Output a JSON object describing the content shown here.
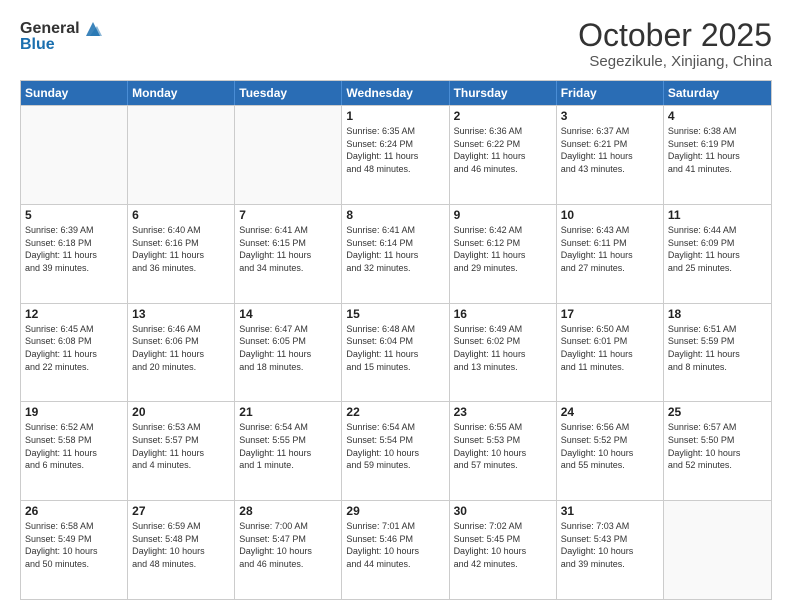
{
  "header": {
    "logo_general": "General",
    "logo_blue": "Blue",
    "month": "October 2025",
    "location": "Segezikule, Xinjiang, China"
  },
  "days_of_week": [
    "Sunday",
    "Monday",
    "Tuesday",
    "Wednesday",
    "Thursday",
    "Friday",
    "Saturday"
  ],
  "weeks": [
    [
      {
        "day": "",
        "info": ""
      },
      {
        "day": "",
        "info": ""
      },
      {
        "day": "",
        "info": ""
      },
      {
        "day": "1",
        "info": "Sunrise: 6:35 AM\nSunset: 6:24 PM\nDaylight: 11 hours\nand 48 minutes."
      },
      {
        "day": "2",
        "info": "Sunrise: 6:36 AM\nSunset: 6:22 PM\nDaylight: 11 hours\nand 46 minutes."
      },
      {
        "day": "3",
        "info": "Sunrise: 6:37 AM\nSunset: 6:21 PM\nDaylight: 11 hours\nand 43 minutes."
      },
      {
        "day": "4",
        "info": "Sunrise: 6:38 AM\nSunset: 6:19 PM\nDaylight: 11 hours\nand 41 minutes."
      }
    ],
    [
      {
        "day": "5",
        "info": "Sunrise: 6:39 AM\nSunset: 6:18 PM\nDaylight: 11 hours\nand 39 minutes."
      },
      {
        "day": "6",
        "info": "Sunrise: 6:40 AM\nSunset: 6:16 PM\nDaylight: 11 hours\nand 36 minutes."
      },
      {
        "day": "7",
        "info": "Sunrise: 6:41 AM\nSunset: 6:15 PM\nDaylight: 11 hours\nand 34 minutes."
      },
      {
        "day": "8",
        "info": "Sunrise: 6:41 AM\nSunset: 6:14 PM\nDaylight: 11 hours\nand 32 minutes."
      },
      {
        "day": "9",
        "info": "Sunrise: 6:42 AM\nSunset: 6:12 PM\nDaylight: 11 hours\nand 29 minutes."
      },
      {
        "day": "10",
        "info": "Sunrise: 6:43 AM\nSunset: 6:11 PM\nDaylight: 11 hours\nand 27 minutes."
      },
      {
        "day": "11",
        "info": "Sunrise: 6:44 AM\nSunset: 6:09 PM\nDaylight: 11 hours\nand 25 minutes."
      }
    ],
    [
      {
        "day": "12",
        "info": "Sunrise: 6:45 AM\nSunset: 6:08 PM\nDaylight: 11 hours\nand 22 minutes."
      },
      {
        "day": "13",
        "info": "Sunrise: 6:46 AM\nSunset: 6:06 PM\nDaylight: 11 hours\nand 20 minutes."
      },
      {
        "day": "14",
        "info": "Sunrise: 6:47 AM\nSunset: 6:05 PM\nDaylight: 11 hours\nand 18 minutes."
      },
      {
        "day": "15",
        "info": "Sunrise: 6:48 AM\nSunset: 6:04 PM\nDaylight: 11 hours\nand 15 minutes."
      },
      {
        "day": "16",
        "info": "Sunrise: 6:49 AM\nSunset: 6:02 PM\nDaylight: 11 hours\nand 13 minutes."
      },
      {
        "day": "17",
        "info": "Sunrise: 6:50 AM\nSunset: 6:01 PM\nDaylight: 11 hours\nand 11 minutes."
      },
      {
        "day": "18",
        "info": "Sunrise: 6:51 AM\nSunset: 5:59 PM\nDaylight: 11 hours\nand 8 minutes."
      }
    ],
    [
      {
        "day": "19",
        "info": "Sunrise: 6:52 AM\nSunset: 5:58 PM\nDaylight: 11 hours\nand 6 minutes."
      },
      {
        "day": "20",
        "info": "Sunrise: 6:53 AM\nSunset: 5:57 PM\nDaylight: 11 hours\nand 4 minutes."
      },
      {
        "day": "21",
        "info": "Sunrise: 6:54 AM\nSunset: 5:55 PM\nDaylight: 11 hours\nand 1 minute."
      },
      {
        "day": "22",
        "info": "Sunrise: 6:54 AM\nSunset: 5:54 PM\nDaylight: 10 hours\nand 59 minutes."
      },
      {
        "day": "23",
        "info": "Sunrise: 6:55 AM\nSunset: 5:53 PM\nDaylight: 10 hours\nand 57 minutes."
      },
      {
        "day": "24",
        "info": "Sunrise: 6:56 AM\nSunset: 5:52 PM\nDaylight: 10 hours\nand 55 minutes."
      },
      {
        "day": "25",
        "info": "Sunrise: 6:57 AM\nSunset: 5:50 PM\nDaylight: 10 hours\nand 52 minutes."
      }
    ],
    [
      {
        "day": "26",
        "info": "Sunrise: 6:58 AM\nSunset: 5:49 PM\nDaylight: 10 hours\nand 50 minutes."
      },
      {
        "day": "27",
        "info": "Sunrise: 6:59 AM\nSunset: 5:48 PM\nDaylight: 10 hours\nand 48 minutes."
      },
      {
        "day": "28",
        "info": "Sunrise: 7:00 AM\nSunset: 5:47 PM\nDaylight: 10 hours\nand 46 minutes."
      },
      {
        "day": "29",
        "info": "Sunrise: 7:01 AM\nSunset: 5:46 PM\nDaylight: 10 hours\nand 44 minutes."
      },
      {
        "day": "30",
        "info": "Sunrise: 7:02 AM\nSunset: 5:45 PM\nDaylight: 10 hours\nand 42 minutes."
      },
      {
        "day": "31",
        "info": "Sunrise: 7:03 AM\nSunset: 5:43 PM\nDaylight: 10 hours\nand 39 minutes."
      },
      {
        "day": "",
        "info": ""
      }
    ]
  ]
}
